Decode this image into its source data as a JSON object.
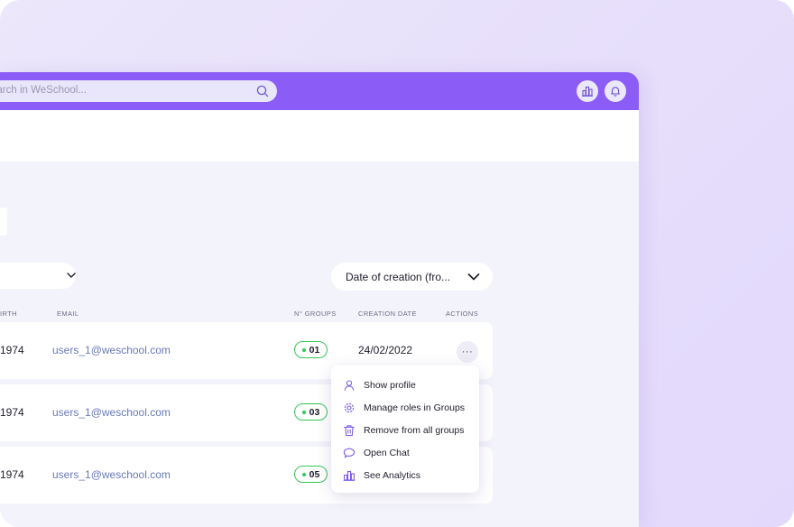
{
  "topbar": {
    "search_placeholder": "earch in WeSchool...",
    "analytics_icon": "bar-chart-icon",
    "notifications_icon": "bell-icon"
  },
  "sort": {
    "label": "Date of creation (fro..."
  },
  "table": {
    "headers": {
      "birth": "IRTH",
      "email": "EMAIL",
      "groups": "N° GROUPS",
      "creation_date": "CREATION DATE",
      "actions": "ACTIONS"
    },
    "rows": [
      {
        "year": "1974",
        "email": "users_1@weschool.com",
        "groups": "01",
        "creation_date": "24/02/2022",
        "more": "···"
      },
      {
        "year": "1974",
        "email": "users_1@weschool.com",
        "groups": "03"
      },
      {
        "year": "1974",
        "email": "users_1@weschool.com",
        "groups": "05"
      }
    ]
  },
  "actions_menu": {
    "items": [
      {
        "label": "Show profile",
        "icon": "user-icon"
      },
      {
        "label": "Manage roles in Groups",
        "icon": "gear-icon"
      },
      {
        "label": "Remove from all groups",
        "icon": "trash-icon"
      },
      {
        "label": "Open Chat",
        "icon": "chat-bubble-icon"
      },
      {
        "label": "See Analytics",
        "icon": "bar-chart-icon"
      }
    ]
  },
  "colors": {
    "brand": "#8b5cf6",
    "badge_green": "#34c759",
    "email_text": "#6a7ab8",
    "page_background": "#f3f3fb"
  }
}
